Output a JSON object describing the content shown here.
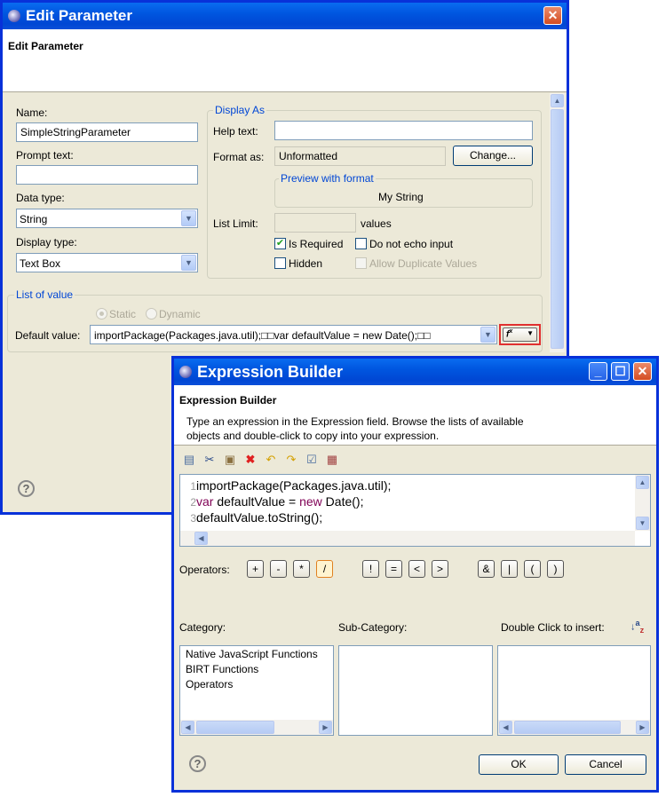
{
  "edit_param": {
    "title": "Edit Parameter",
    "banner_title": "Edit Parameter",
    "name_label": "Name:",
    "name_value": "SimpleStringParameter",
    "prompt_label": "Prompt text:",
    "prompt_value": "",
    "datatype_label": "Data type:",
    "datatype_value": "String",
    "displaytype_label": "Display type:",
    "displaytype_value": "Text Box",
    "display_as_title": "Display As",
    "help_label": "Help text:",
    "help_value": "",
    "format_label": "Format as:",
    "format_value": "Unformatted",
    "change_button": "Change...",
    "preview_title": "Preview with format",
    "preview_value": "My String",
    "list_limit_label": "List Limit:",
    "list_limit_value": "",
    "values_label": "values",
    "is_required_label": "Is Required",
    "no_echo_label": "Do not echo input",
    "hidden_label": "Hidden",
    "allow_dup_label": "Allow Duplicate Values",
    "list_of_value_title": "List of value",
    "static_label": "Static",
    "dynamic_label": "Dynamic",
    "default_value_label": "Default value:",
    "default_value": "importPackage(Packages.java.util);□□var defaultValue = new Date();□□",
    "is_required_checked": true,
    "no_echo_checked": false,
    "hidden_checked": false
  },
  "expr": {
    "title": "Expression Builder",
    "banner_title": "Expression Builder",
    "description_line1": "Type an expression in the Expression field. Browse the lists of available",
    "description_line2": "objects and double-click to copy into your expression.",
    "code_lines": [
      {
        "num": "1",
        "text": "importPackage(Packages.java.util);"
      },
      {
        "num": "2",
        "kw1": "var",
        "text": " defaultValue = ",
        "kw2": "new",
        "text2": " Date();"
      },
      {
        "num": "3",
        "text": "defaultValue.toString();"
      }
    ],
    "operators_label": "Operators:",
    "operators": [
      "+",
      "-",
      "*",
      "/",
      "!",
      "=",
      "<",
      ">",
      "&",
      "|",
      "(",
      ")"
    ],
    "category_label": "Category:",
    "subcategory_label": "Sub-Category:",
    "insert_label": "Double Click to insert:",
    "categories": [
      "Native JavaScript Functions",
      "BIRT Functions",
      "Operators"
    ],
    "ok_button": "OK",
    "cancel_button": "Cancel"
  }
}
